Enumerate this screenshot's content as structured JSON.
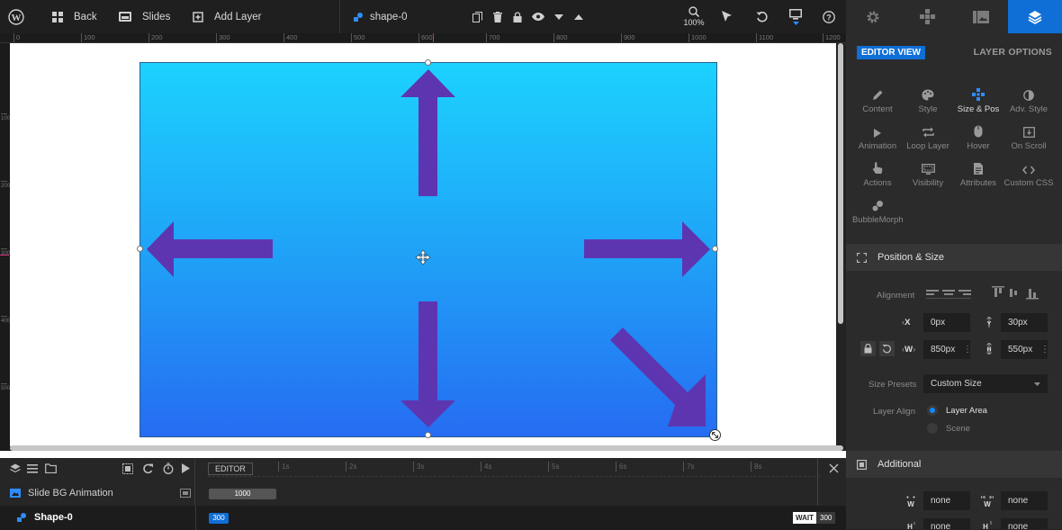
{
  "topbar": {
    "back_label": "Back",
    "slides_label": "Slides",
    "add_layer_label": "Add Layer",
    "current_layer": "shape-0",
    "zoom": "100%"
  },
  "ruler": {
    "labels": [
      "0",
      "100",
      "200",
      "300",
      "400",
      "500",
      "600",
      "700",
      "800",
      "900",
      "1000",
      "1100",
      "1200"
    ],
    "vlabels": [
      "100",
      "200",
      "300",
      "400",
      "500"
    ]
  },
  "timeline": {
    "editor_label": "EDITOR",
    "ticks": [
      "1s",
      "2s",
      "3s",
      "4s",
      "5s",
      "6s",
      "7s",
      "8s"
    ],
    "rows": [
      {
        "label": "Slide BG Animation",
        "bar": "1000"
      },
      {
        "label": "Shape-0",
        "bar": "300",
        "wait_label": "WAIT",
        "wait_value": "300"
      }
    ]
  },
  "panel": {
    "editor_view": "EDITOR VIEW",
    "layer_options": "LAYER OPTIONS",
    "options": [
      {
        "label": "Content",
        "icon": "pencil-icon"
      },
      {
        "label": "Style",
        "icon": "palette-icon"
      },
      {
        "label": "Size & Pos",
        "icon": "move-icon"
      },
      {
        "label": "Adv. Style",
        "icon": "contrast-icon"
      },
      {
        "label": "Animation",
        "icon": "play-icon"
      },
      {
        "label": "Loop Layer",
        "icon": "loop-icon"
      },
      {
        "label": "Hover",
        "icon": "mouse-icon"
      },
      {
        "label": "On Scroll",
        "icon": "scroll-icon"
      },
      {
        "label": "Actions",
        "icon": "pointer-icon"
      },
      {
        "label": "Visibility",
        "icon": "screen-icon"
      },
      {
        "label": "Attributes",
        "icon": "document-icon"
      },
      {
        "label": "Custom CSS",
        "icon": "code-icon"
      },
      {
        "label": "BubbleMorph",
        "icon": "bubble-icon"
      }
    ],
    "position_size": {
      "title": "Position & Size",
      "alignment_label": "Alignment",
      "x_label": "X",
      "x_value": "0px",
      "y_label": "Y",
      "y_value": "30px",
      "w_label": "W",
      "w_value": "850px",
      "h_label": "H",
      "h_value": "550px",
      "presets_label": "Size Presets",
      "presets_value": "Custom Size",
      "layer_align_label": "Layer Align",
      "layer_area": "Layer Area",
      "scene": "Scene"
    },
    "additional": {
      "title": "Additional",
      "min_w_value": "none",
      "max_w_value": "none",
      "min_h_value": "none",
      "max_h_value": "none"
    }
  },
  "colors": {
    "accent": "#0f6fd6",
    "arrow": "#5e35b1",
    "gradient_top": "#1cd2fe",
    "gradient_bottom": "#266cf2"
  }
}
